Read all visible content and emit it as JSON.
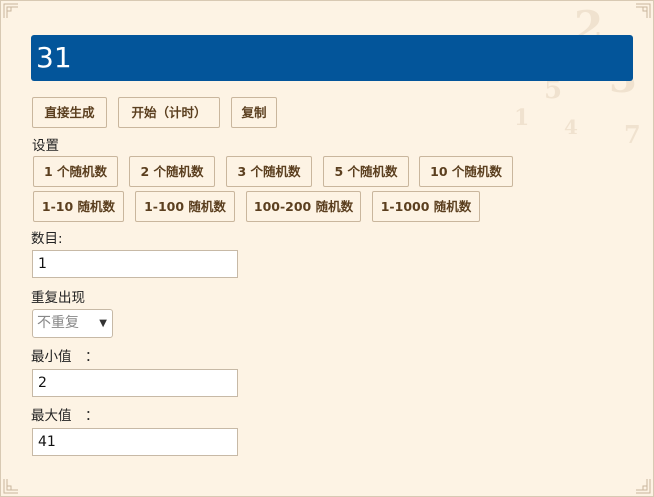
{
  "result": {
    "value": "31"
  },
  "actions": {
    "generate_label": "直接生成",
    "start_label": "开始（计时）",
    "copy_label": "复制"
  },
  "settings": {
    "title": "设置",
    "count_presets": [
      "1 个随机数",
      "2 个随机数",
      "3 个随机数",
      "5 个随机数",
      "10 个随机数"
    ],
    "range_presets": [
      "1-10 随机数",
      "1-100 随机数",
      "100-200 随机数",
      "1-1000 随机数"
    ]
  },
  "form": {
    "count_label": "数目:",
    "count_value": "1",
    "repeat_label": "重复出现",
    "repeat_selected": "不重复",
    "min_label": "最小值　：",
    "min_value": "2",
    "max_label": "最大值　：",
    "max_value": "41"
  },
  "decoration": {
    "glyphs": [
      "2",
      "5",
      "3",
      "1",
      "4",
      "7"
    ]
  },
  "colors": {
    "background": "#fdf3e4",
    "accent": "#03559a",
    "button_text": "#5b3f1f",
    "border": "#c9b69d"
  }
}
